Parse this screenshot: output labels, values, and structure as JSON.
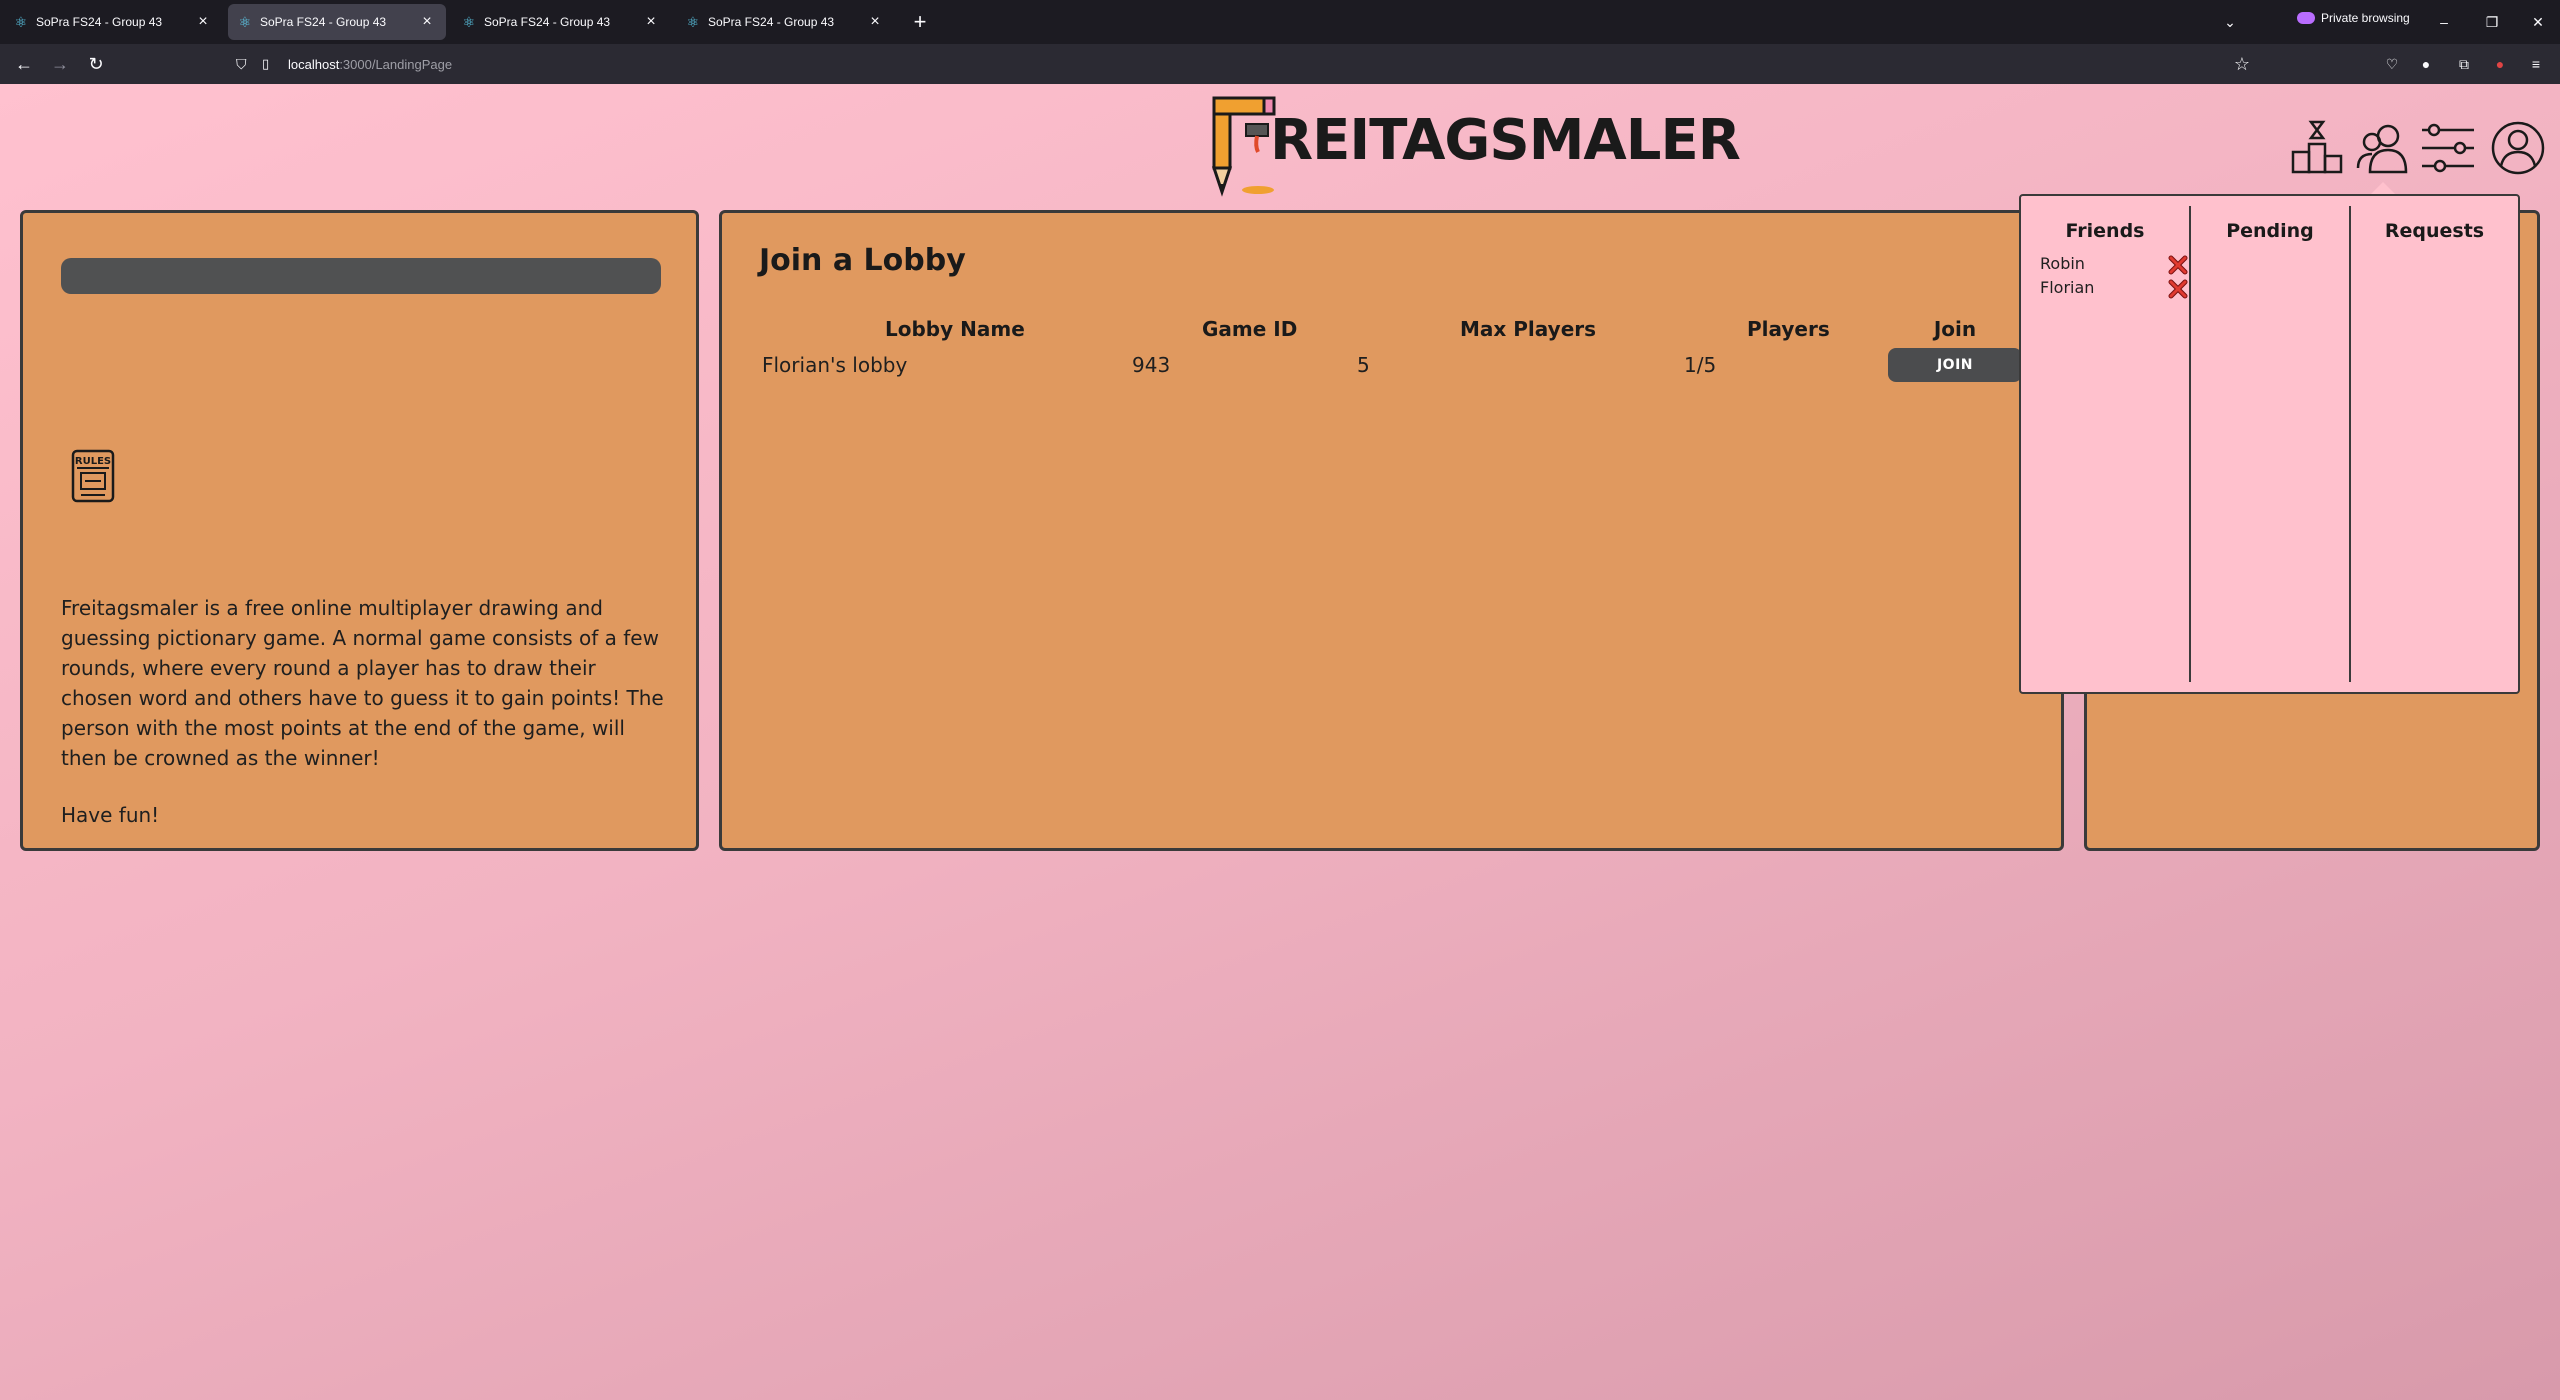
{
  "browser": {
    "tabs": [
      {
        "label": "SoPra FS24 - Group 43",
        "active": false
      },
      {
        "label": "SoPra FS24 - Group 43",
        "active": true
      },
      {
        "label": "SoPra FS24 - Group 43",
        "active": false
      },
      {
        "label": "SoPra FS24 - Group 43",
        "active": false
      }
    ],
    "private_label": "Private browsing",
    "url_host": "localhost",
    "url_rest": ":3000/LandingPage"
  },
  "header": {
    "logo_text": "REITAGSMALER",
    "icons": [
      "leaderboard-icon",
      "friends-icon",
      "settings-icon",
      "profile-icon"
    ]
  },
  "left_panel": {
    "rules_icon_label": "RULES",
    "description": "Freitagsmaler is a free online multiplayer drawing and guessing pictionary game. A normal game consists of a few rounds, where every round a player has to draw their chosen word and others have to guess it to gain points! The person with the most points at the end of the game, will then be crowned as the winner!",
    "closing": "Have fun!"
  },
  "lobby": {
    "title": "Join a Lobby",
    "columns": [
      "Lobby Name",
      "Game ID",
      "Max Players",
      "Players",
      "Join"
    ],
    "rows": [
      {
        "name": "Florian's lobby",
        "game_id": "943",
        "max_players": "5",
        "players": "1/5",
        "join_label": "JOIN"
      }
    ]
  },
  "friends_popup": {
    "columns": [
      "Friends",
      "Pending",
      "Requests"
    ],
    "friends": [
      "Robin",
      "Florian"
    ]
  },
  "colors": {
    "panel": "#e0995f",
    "button": "#4b4c4e",
    "popup": "#ffc1cd",
    "remove": "#c0392b"
  }
}
